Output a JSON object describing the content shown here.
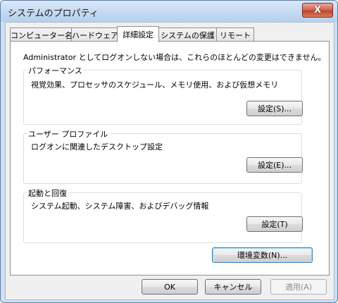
{
  "window": {
    "title": "システムのプロパティ",
    "close_label": "X"
  },
  "tabs": [
    {
      "label": "コンピューター名"
    },
    {
      "label": "ハードウェア"
    },
    {
      "label": "詳細設定"
    },
    {
      "label": "システムの保護"
    },
    {
      "label": "リモート"
    }
  ],
  "active_tab": "詳細設定",
  "intro_text": "Administrator としてログオンしない場合は、これらのほとんどの変更はできません。",
  "groups": [
    {
      "title": "パフォーマンス",
      "description": "視覚効果、プロセッサのスケジュール、メモリ使用、および仮想メモリ",
      "button": "設定(S)..."
    },
    {
      "title": "ユーザー プロファイル",
      "description": "ログオンに関連したデスクトップ設定",
      "button": "設定(E)..."
    },
    {
      "title": "起動と回復",
      "description": "システム起動、システム障害、およびデバッグ情報",
      "button": "設定(T)"
    }
  ],
  "env_button": "環境変数(N)...",
  "footer": {
    "ok": "OK",
    "cancel": "キャンセル",
    "apply": "適用(A)"
  }
}
